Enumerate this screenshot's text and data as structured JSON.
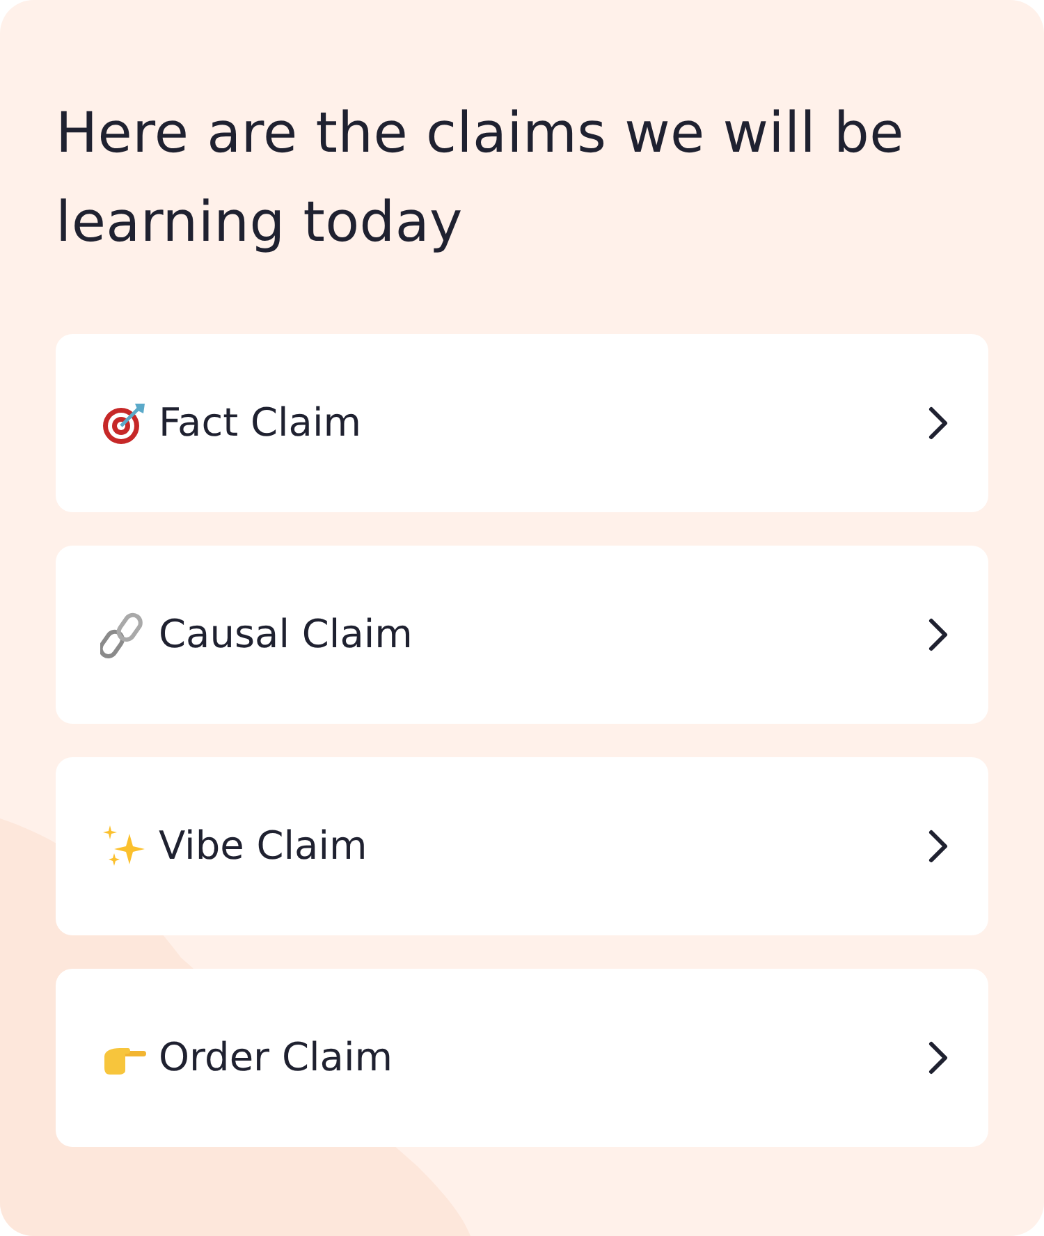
{
  "title": "Here are the claims we will be learning today",
  "claims": [
    {
      "label": "Fact Claim",
      "kind": "target"
    },
    {
      "label": "Causal Claim",
      "kind": "link"
    },
    {
      "label": "Vibe Claim",
      "kind": "sparkles"
    },
    {
      "label": "Order Claim",
      "kind": "pointing"
    }
  ]
}
